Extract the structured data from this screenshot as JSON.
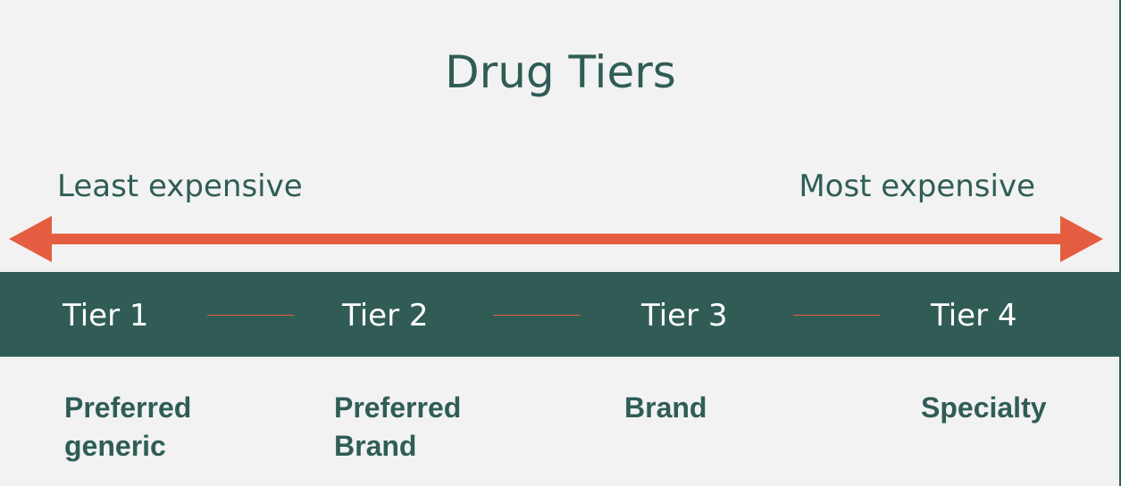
{
  "title": "Drug Tiers",
  "cost_scale": {
    "low_label": "Least expensive",
    "high_label": "Most expensive",
    "arrow_color": "#e55d40"
  },
  "band_color": "#315c56",
  "text_color": "#2f5d56",
  "tiers": [
    {
      "label": "Tier 1",
      "description": "Preferred\ngeneric"
    },
    {
      "label": "Tier 2",
      "description": "Preferred\nBrand"
    },
    {
      "label": "Tier 3",
      "description": "Brand"
    },
    {
      "label": "Tier 4",
      "description": "Specialty"
    }
  ]
}
